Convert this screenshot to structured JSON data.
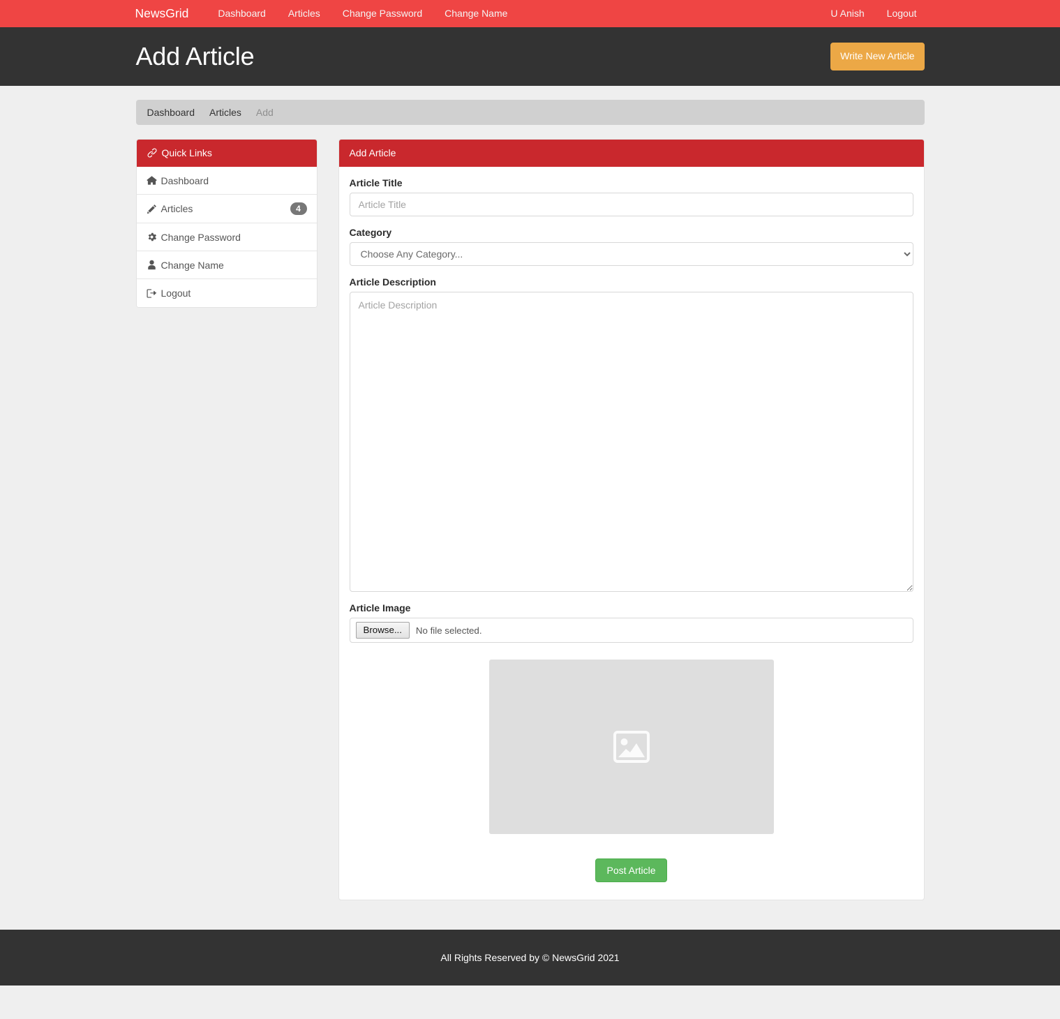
{
  "navbar": {
    "brand": "NewsGrid",
    "links": [
      {
        "label": "Dashboard"
      },
      {
        "label": "Articles"
      },
      {
        "label": "Change Password"
      },
      {
        "label": "Change Name"
      }
    ],
    "right_links": [
      {
        "label": "U Anish"
      },
      {
        "label": "Logout"
      }
    ],
    "bg_color": "#ef4544"
  },
  "page_header": {
    "title": "Add Article",
    "button_label": "Write New Article",
    "button_color": "#eca846",
    "bg_color": "#333333"
  },
  "breadcrumb": {
    "items": [
      {
        "label": "Dashboard",
        "active": false
      },
      {
        "label": "Articles",
        "active": false
      },
      {
        "label": "Add",
        "active": true
      }
    ]
  },
  "sidebar": {
    "header": "Quick Links",
    "header_icon": "link-icon",
    "header_color": "#c9282d",
    "items": [
      {
        "label": "Dashboard",
        "icon": "home-icon",
        "badge": ""
      },
      {
        "label": "Articles",
        "icon": "pencil-icon",
        "badge": "4"
      },
      {
        "label": "Change Password",
        "icon": "gear-icon",
        "badge": ""
      },
      {
        "label": "Change Name",
        "icon": "user-icon",
        "badge": ""
      },
      {
        "label": "Logout",
        "icon": "sign-out-icon",
        "badge": ""
      }
    ],
    "badge_color": "#777777"
  },
  "form_card": {
    "header": "Add Article",
    "header_color": "#c9282d",
    "fields": {
      "title_label": "Article Title",
      "title_placeholder": "Article Title",
      "title_value": "",
      "category_label": "Category",
      "category_selected": "Choose Any Category...",
      "category_options": [
        "Choose Any Category..."
      ],
      "description_label": "Article Description",
      "description_placeholder": "Article Description",
      "description_value": "",
      "image_label": "Article Image",
      "image_browse_label": "Browse...",
      "image_status": "No file selected.",
      "image_placeholder_icon": "image-placeholder-icon"
    },
    "submit_label": "Post Article",
    "submit_color": "#5cb85c"
  },
  "footer": {
    "text": "All Rights Reserved by © NewsGrid 2021",
    "bg_color": "#333333"
  }
}
